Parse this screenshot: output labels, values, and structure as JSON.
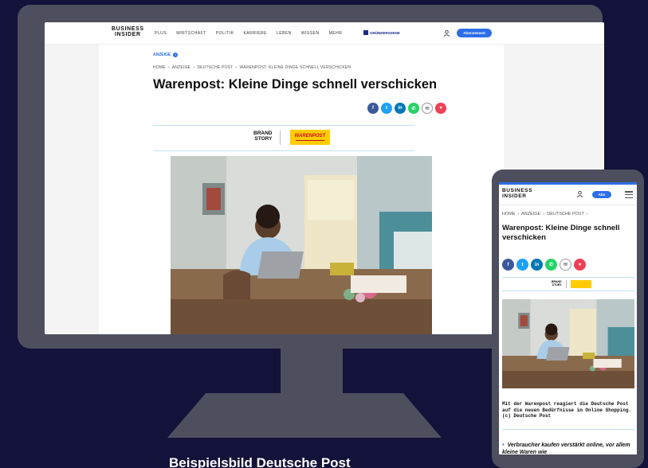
{
  "desktop": {
    "logo": "BUSINESS\nINSIDER",
    "nav_items": [
      "PLUS",
      "WIRTSCHAFT",
      "POLITIK",
      "KARRIERE",
      "LEBEN",
      "WISSEN",
      "MEHR"
    ],
    "gruenderszene": "GRÜNDERSZENE",
    "subscribe_label": "Abonnement",
    "anzeige": "ANZEIGE",
    "breadcrumb": "HOME  ›  ANZEIGE  ›  DEUTSCHE POST  ›  WARENPOST: KLEINE DINGE SCHNELL VERSCHICKEN",
    "title": "Warenpost: Kleine Dinge schnell verschicken",
    "brand_story": "BRAND\nSTORY",
    "warenpost_logo": "WARENPOST"
  },
  "share_buttons": [
    {
      "icon": "facebook-icon",
      "glyph": "f",
      "color": "#3b5998"
    },
    {
      "icon": "twitter-icon",
      "glyph": "t",
      "color": "#1da1f2"
    },
    {
      "icon": "linkedin-icon",
      "glyph": "in",
      "color": "#0077b5"
    },
    {
      "icon": "whatsapp-icon",
      "glyph": "✆",
      "color": "#25d366"
    },
    {
      "icon": "email-icon",
      "glyph": "✉",
      "color": "#ffffff"
    },
    {
      "icon": "pocket-icon",
      "glyph": "♥",
      "color": "#ef3f56"
    }
  ],
  "mobile": {
    "logo": "BUSINESS\nINSIDER",
    "subscribe_label": "Abo",
    "breadcrumb": "HOME  ›  ANZEIGE  ›  DEUTSCHE POST  ›",
    "title": "Warenpost: Kleine Dinge schnell verschicken",
    "brand_story": "BRAND\nSTORY",
    "caption": "Mit der Warenpost reagiert die Deutsche Post auf die neuen Bedürfnisse im Online Shopping. (c) Deutsche Post",
    "bullet": "Verbraucher kaufen verstärkt online, vor allem kleine Waren wie"
  },
  "footer_caption": "Beispielsbild Deutsche Post"
}
